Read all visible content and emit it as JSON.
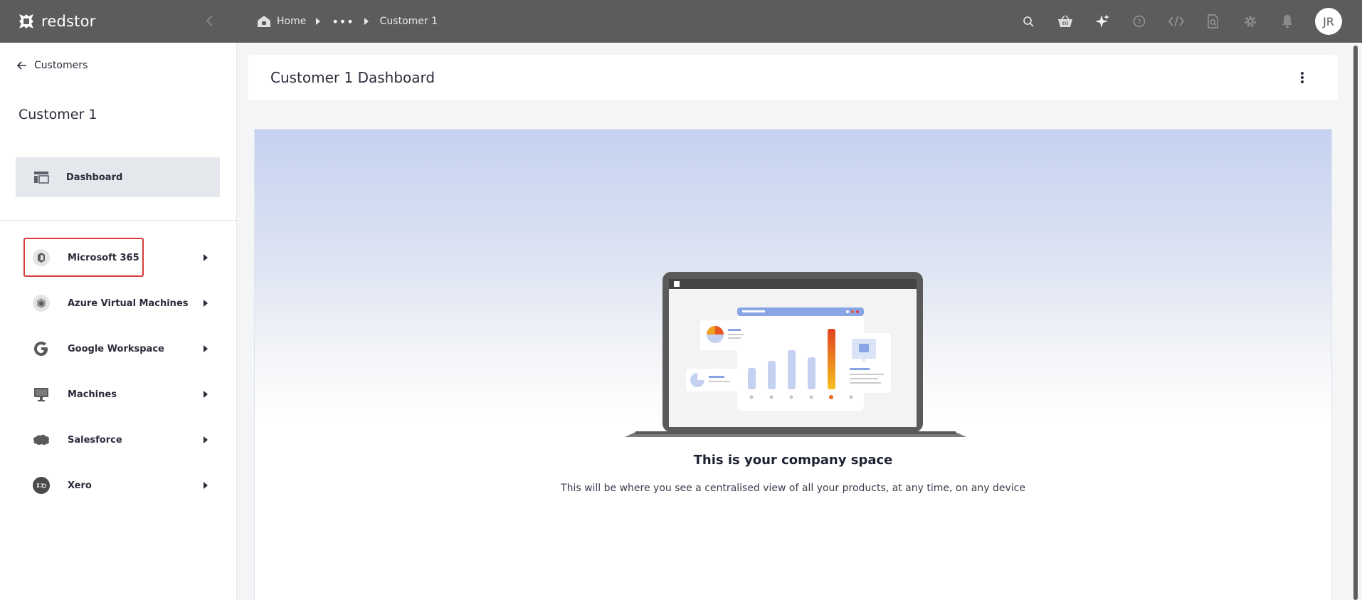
{
  "app": {
    "name": "redstor"
  },
  "breadcrumb": {
    "home": "Home",
    "ellipsis": "•••",
    "current": "Customer 1"
  },
  "topbar": {
    "icons": [
      "search-icon",
      "basket-icon",
      "sparkle-icon",
      "help-icon",
      "code-icon",
      "search-document-icon",
      "gear-icon",
      "bell-icon"
    ],
    "avatar_initials": "JR"
  },
  "sidebar": {
    "back_label": "Customers",
    "customer_name": "Customer 1",
    "dashboard_label": "Dashboard",
    "items": [
      {
        "label": "Microsoft 365",
        "icon": "microsoft-365-icon"
      },
      {
        "label": "Azure Virtual Machines",
        "icon": "azure-vm-icon"
      },
      {
        "label": "Google Workspace",
        "icon": "google-icon"
      },
      {
        "label": "Machines",
        "icon": "monitor-icon"
      },
      {
        "label": "Salesforce",
        "icon": "salesforce-icon"
      },
      {
        "label": "Xero",
        "icon": "xero-icon"
      }
    ]
  },
  "main": {
    "title": "Customer 1 Dashboard",
    "empty_title": "This is your company space",
    "empty_subtitle": "This will be where you see a centralised view of all your products, at any time, on any device"
  },
  "colors": {
    "topbar": "#5c5c5c",
    "highlight": "#d93a3a",
    "panel_top": "#c5d1f0",
    "accent_bar": "#e8571f"
  }
}
